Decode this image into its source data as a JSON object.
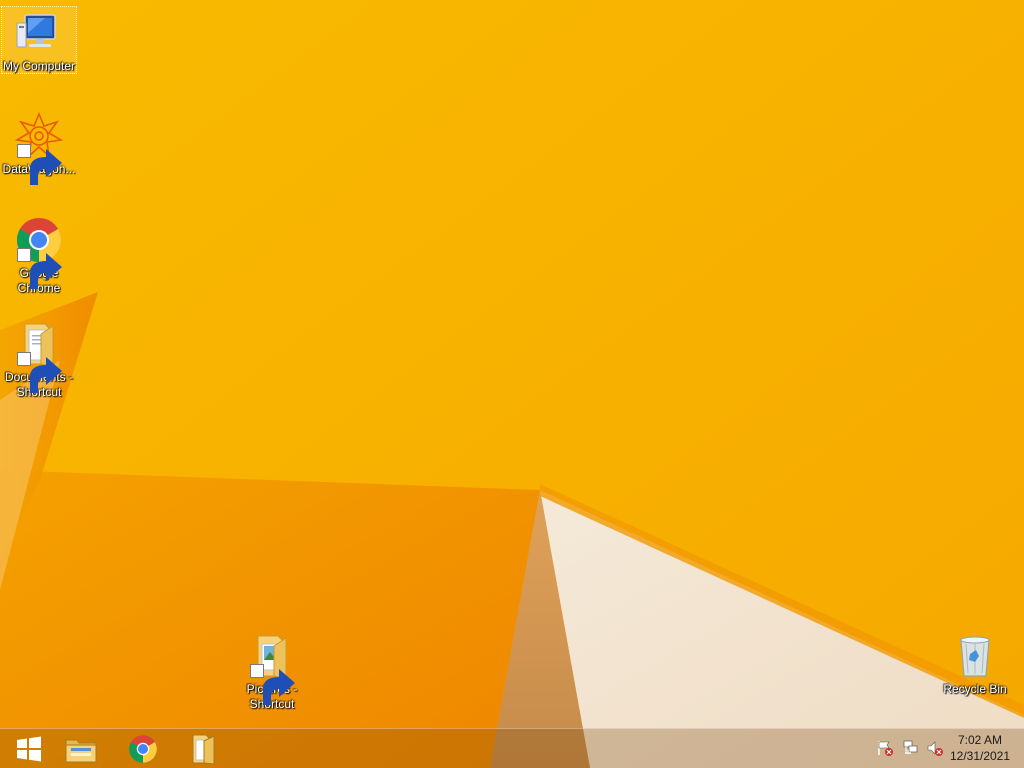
{
  "desktop": {
    "icons": [
      {
        "label": "My Computer",
        "icon": "my-computer-icon",
        "shortcut": false,
        "selected": true
      },
      {
        "label": "DataWagon...",
        "icon": "datawagon-icon",
        "shortcut": true,
        "selected": false
      },
      {
        "label": "Google Chrome",
        "icon": "chrome-icon",
        "shortcut": true,
        "selected": false
      },
      {
        "label": "Documents - Shortcut",
        "icon": "documents-folder-icon",
        "shortcut": true,
        "selected": false
      },
      {
        "label": "Pictures - Shortcut",
        "icon": "pictures-folder-icon",
        "shortcut": true,
        "selected": false
      },
      {
        "label": "Recycle Bin",
        "icon": "recycle-bin-icon",
        "shortcut": false,
        "selected": false
      }
    ]
  },
  "taskbar": {
    "pinned": [
      {
        "name": "start-button",
        "icon": "windows-logo-icon"
      },
      {
        "name": "file-explorer",
        "icon": "file-explorer-icon"
      },
      {
        "name": "google-chrome",
        "icon": "chrome-icon"
      },
      {
        "name": "folder",
        "icon": "folder-icon"
      }
    ],
    "tray": {
      "icons": [
        "action-center-flag-icon",
        "network-icon",
        "volume-muted-icon"
      ],
      "time": "7:02 AM",
      "date": "12/31/2021"
    }
  },
  "colors": {
    "wallpaper_yellow": "#f7b500",
    "wallpaper_orange": "#f08a00",
    "wallpaper_cream": "#f3e6d3"
  }
}
